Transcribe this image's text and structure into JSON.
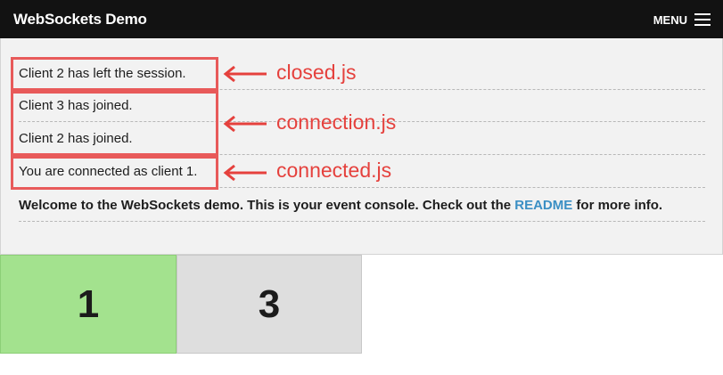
{
  "navbar": {
    "title": "WebSockets Demo",
    "menu_label": "MENU"
  },
  "console": {
    "messages": [
      "Client 2 has left the session.",
      "Client 3 has joined.",
      "Client 2 has joined.",
      "You are connected as client 1."
    ],
    "welcome": {
      "before": "Welcome to the WebSockets demo. This is your event console. Check out the ",
      "link": "README",
      "after": " for more info."
    }
  },
  "annotations": [
    {
      "label": "closed.js"
    },
    {
      "label": "connection.js"
    },
    {
      "label": "connected.js"
    }
  ],
  "clients": [
    {
      "label": "1",
      "color": "#a3e28e",
      "status": "current"
    },
    {
      "label": "3",
      "color": "#dedede",
      "status": "other"
    }
  ],
  "colors": {
    "annotation": "#e5413d",
    "link": "#3b8fc4",
    "navbar": "#121212"
  }
}
